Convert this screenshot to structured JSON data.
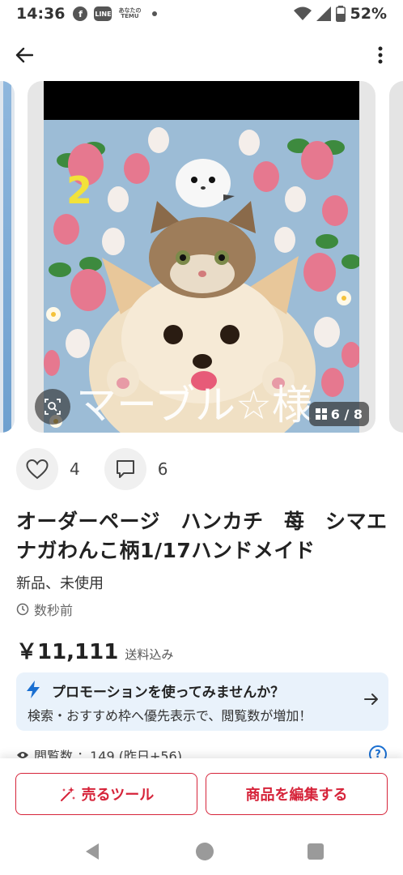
{
  "status_bar": {
    "time": "14:36",
    "icons": [
      "facebook-icon",
      "line-icon",
      "temu-icon",
      "notification-dot",
      "wifi-icon",
      "signal-icon",
      "battery-icon"
    ],
    "line_label": "LINE",
    "temu_label_top": "あなたの",
    "temu_label_bottom": "TEMU",
    "battery": "52%"
  },
  "carousel": {
    "badge_number": "2",
    "watermark": "マーブル☆様",
    "counter": "6 / 8",
    "current_index": 6,
    "total": 8
  },
  "actions": {
    "likes": "4",
    "comments": "6"
  },
  "item": {
    "title": "オーダーページ　ハンカチ　苺　シマエナガわんこ柄1/17ハンドメイド",
    "condition": "新品、未使用",
    "posted": "数秒前",
    "price": "￥11,111",
    "shipping": "送料込み"
  },
  "promo": {
    "title": "プロモーションを使ってみませんか？",
    "subtitle": "検索・おすすめ枠へ優先表示で、閲覧数が増加！"
  },
  "views": {
    "text": "閲覧数 ：149 (昨日+56)"
  },
  "bottom_actions": {
    "sell_tool": "売るツール",
    "edit_item": "商品を編集する"
  },
  "colors": {
    "accent_red": "#d6243a",
    "promo_bg": "#e9f2fb",
    "link_blue": "#1a6fd1"
  }
}
